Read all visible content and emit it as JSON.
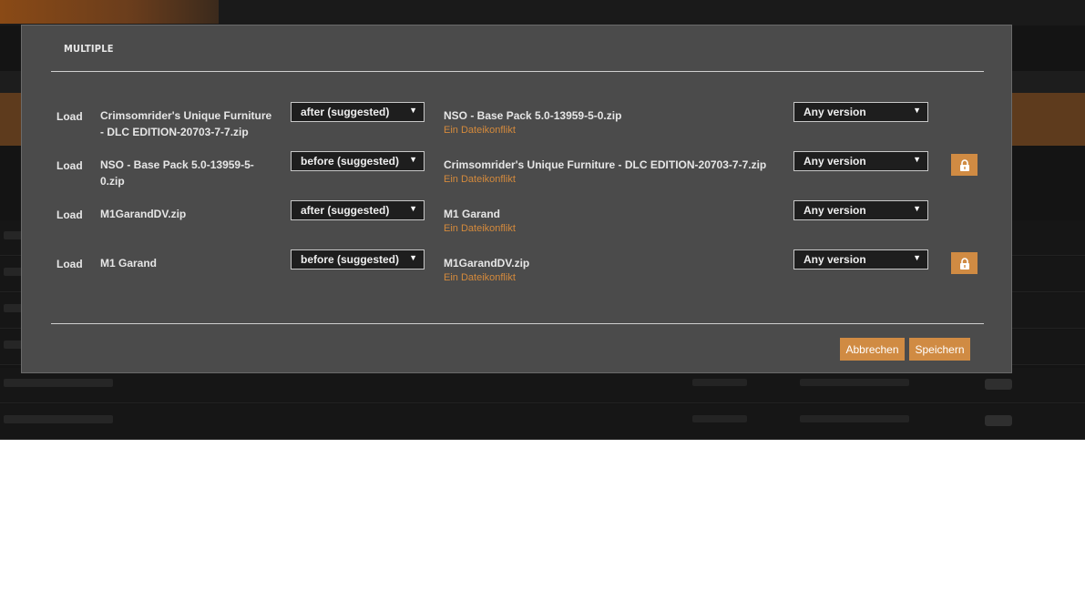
{
  "dialog": {
    "title": "MULTIPLE",
    "cancel_label": "Abbrechen",
    "save_label": "Speichern",
    "accent_color": "#d08b43",
    "conflict_color": "#d48a3c"
  },
  "rules": [
    {
      "action": "Load",
      "source": "Crimsomrider's Unique Furniture - DLC EDITION-20703-7-7.zip",
      "order": "after (suggested)",
      "target": "NSO - Base Pack 5.0-13959-5-0.zip",
      "conflict": "Ein Dateikonflikt",
      "version": "Any version",
      "locked": false
    },
    {
      "action": "Load",
      "source": "NSO - Base Pack 5.0-13959-5-0.zip",
      "order": "before (suggested)",
      "target": "Crimsomrider's Unique Furniture - DLC EDITION-20703-7-7.zip",
      "conflict": "Ein Dateikonflikt",
      "version": "Any version",
      "locked": true
    },
    {
      "action": "Load",
      "source": "M1GarandDV.zip",
      "order": "after (suggested)",
      "target": "M1 Garand",
      "conflict": "Ein Dateikonflikt",
      "version": "Any version",
      "locked": false
    },
    {
      "action": "Load",
      "source": "M1 Garand",
      "order": "before (suggested)",
      "target": "M1GarandDV.zip",
      "conflict": "Ein Dateikonflikt",
      "version": "Any version",
      "locked": true
    }
  ],
  "icons": {
    "dropdown": "chevron-down-icon",
    "lock": "lock-icon"
  }
}
